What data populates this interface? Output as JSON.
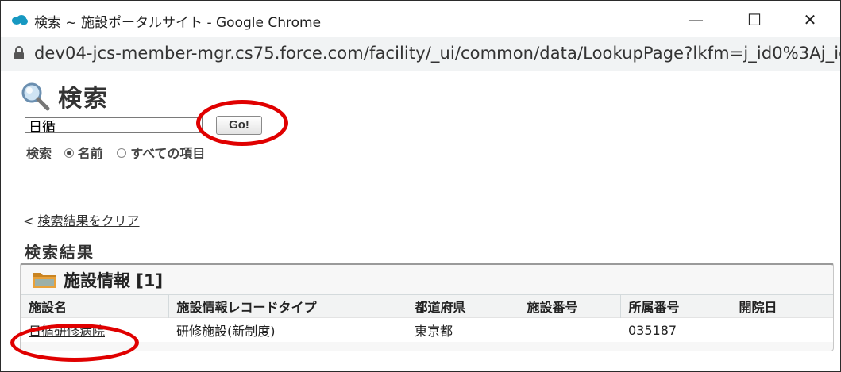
{
  "window": {
    "title": "検索 ~ 施設ポータルサイト - Google Chrome",
    "minimize": "—",
    "maximize": "☐",
    "close": "✕"
  },
  "address": {
    "url": "dev04-jcs-member-mgr.cs75.force.com/facility/_ui/common/data/LookupPage?lkfm=j_id0%3Aj_id..."
  },
  "search": {
    "title": "検索",
    "value": "日循",
    "go_label": "Go!",
    "scope_label": "検索",
    "option_name": "名前",
    "option_all": "すべての項目"
  },
  "results": {
    "clear_prefix": "<",
    "clear_label": "検索結果をクリア",
    "title": "検索結果",
    "panel_title": "施設情報 [1]",
    "columns": [
      "施設名",
      "施設情報レコードタイプ",
      "都道府県",
      "施設番号",
      "所属番号",
      "開院日"
    ],
    "rows": [
      [
        "日循研修病院",
        "研修施設(新制度)",
        "東京都",
        "",
        "035187",
        ""
      ]
    ]
  },
  "colors": {
    "highlight": "#e00000",
    "salesforce_blue": "#1798c1",
    "folder": "#e8a13a"
  }
}
